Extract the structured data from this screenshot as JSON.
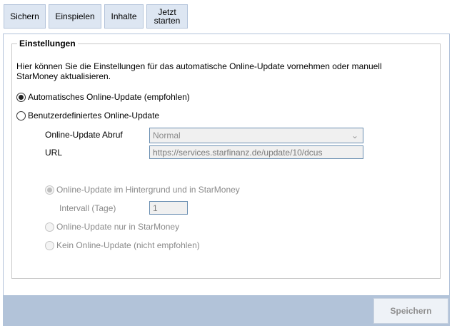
{
  "toolbar": {
    "sichern": "Sichern",
    "einspielen": "Einspielen",
    "inhalte": "Inhalte",
    "jetzt_starten": "Jetzt\nstarten"
  },
  "settings": {
    "title": "Einstellungen",
    "description": "Hier können Sie die Einstellungen für das automatische Online-Update vornehmen oder manuell StarMoney aktualisieren.",
    "radio_auto": "Automatisches Online-Update (empfohlen)",
    "radio_custom": "Benutzerdefiniertes Online-Update",
    "abruf_label": "Online-Update Abruf",
    "abruf_value": "Normal",
    "url_label": "URL",
    "url_value": "https://services.starfinanz.de/update/10/dcus",
    "radio_background": "Online-Update im Hintergrund und in StarMoney",
    "interval_label": "Intervall (Tage)",
    "interval_value": "1",
    "radio_only_starmoney": "Online-Update nur in StarMoney",
    "radio_none": "Kein Online-Update (nicht empfohlen)"
  },
  "footer": {
    "save_label": "Speichern"
  },
  "icons": {
    "select_chevron": "chevron-down-icon"
  }
}
